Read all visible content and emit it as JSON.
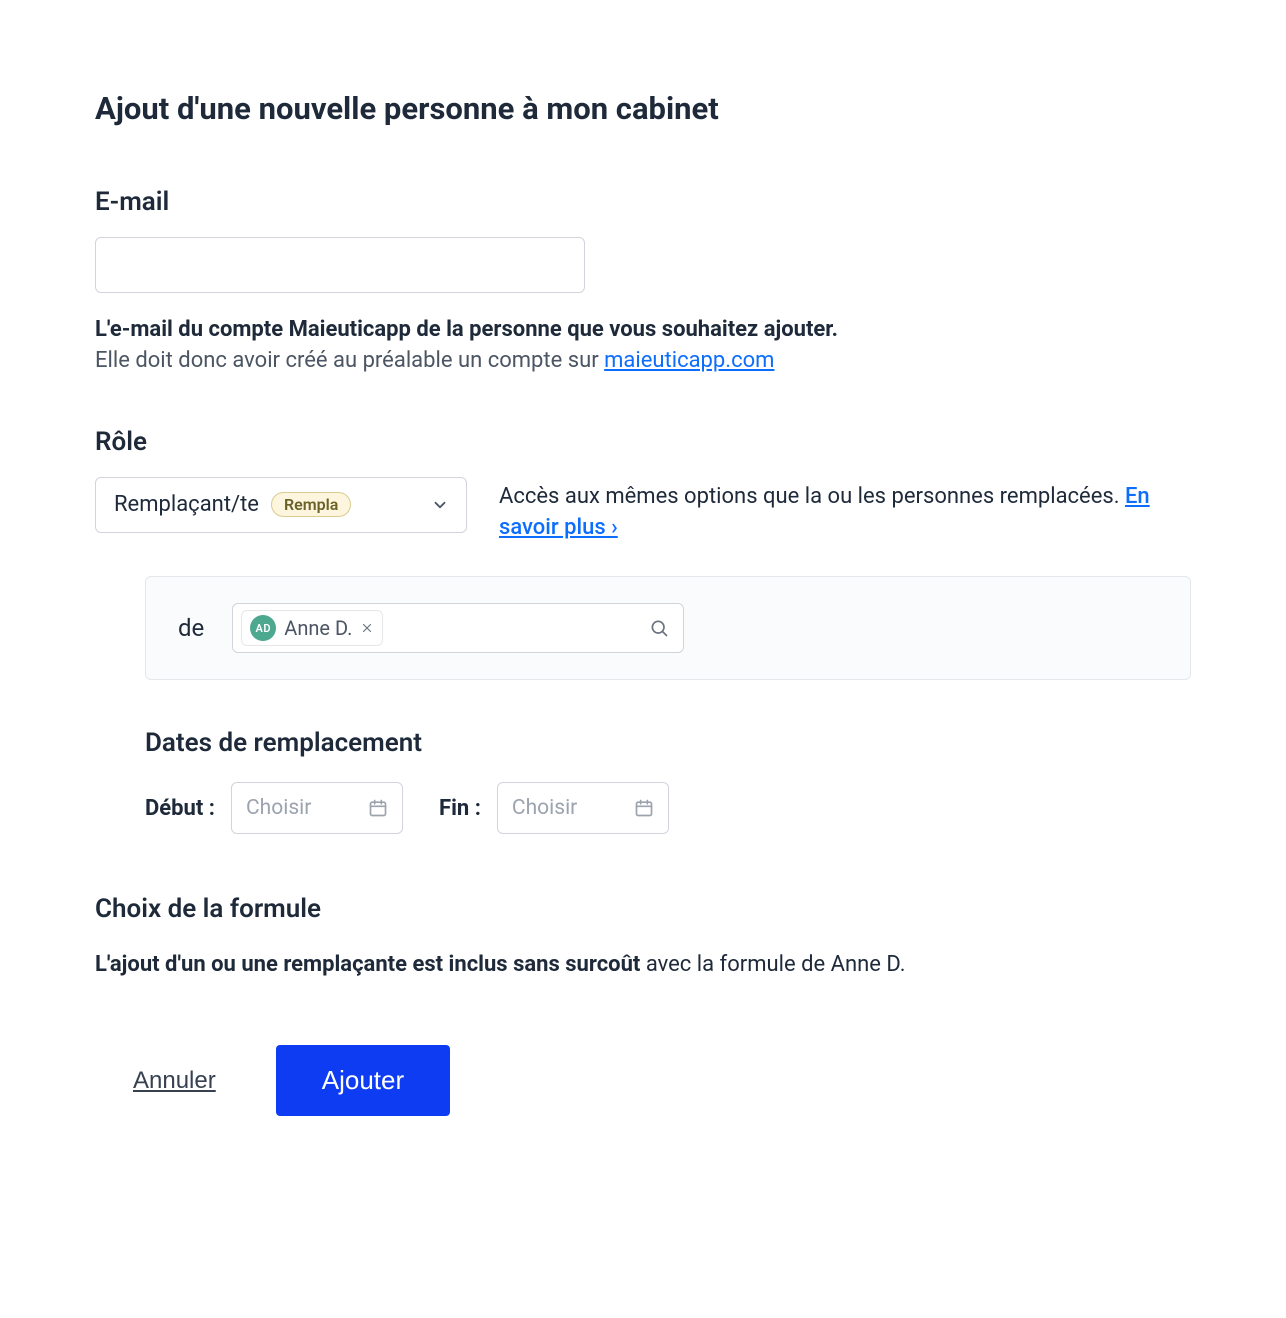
{
  "title": "Ajout d'une nouvelle personne à mon cabinet",
  "email": {
    "label": "E-mail",
    "value": "",
    "help_bold": "L'e-mail du compte Maieuticapp de la personne que vous souhaitez ajouter.",
    "help_text": "Elle doit donc avoir créé au préalable un compte sur ",
    "help_link_text": "maieuticapp.com"
  },
  "role": {
    "label": "Rôle",
    "selected": "Remplaçant/te",
    "badge": "Rempla",
    "desc_text": "Accès aux mêmes options que la ou les personnes remplacées. ",
    "desc_link": "En savoir plus ›"
  },
  "replaced": {
    "de_label": "de",
    "person_initials": "AD",
    "person_name": "Anne D."
  },
  "dates": {
    "title": "Dates de remplacement",
    "start_label": "Début :",
    "end_label": "Fin :",
    "placeholder": "Choisir"
  },
  "formula": {
    "title": "Choix de la formule",
    "bold_part": "L'ajout d'un ou une remplaçante est inclus sans surcoût",
    "rest_part": " avec la formule de Anne D."
  },
  "actions": {
    "cancel": "Annuler",
    "submit": "Ajouter"
  }
}
